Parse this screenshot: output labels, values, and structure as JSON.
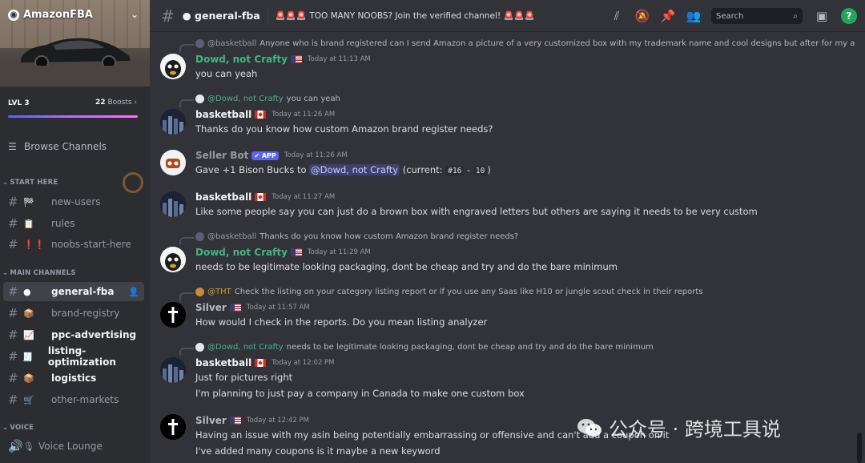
{
  "server": {
    "name": "AmazonFBA",
    "level": "LVL 3",
    "boosts_count": "22",
    "boosts_label": "Boosts"
  },
  "sidebar": {
    "browse_label": "Browse Channels",
    "categories": [
      {
        "label": "START HERE"
      },
      {
        "label": "MAIN CHANNELS"
      },
      {
        "label": "VOICE"
      }
    ],
    "channels": [
      {
        "emoji": "🏁",
        "label": "new-users"
      },
      {
        "emoji": "📋",
        "label": "rules"
      },
      {
        "emoji": "❗❗",
        "label": "noobs-start-here"
      },
      {
        "emoji": "●",
        "label": "general-fba"
      },
      {
        "emoji": "📦",
        "label": "brand-registry"
      },
      {
        "emoji": "📈",
        "label": "ppc-advertising"
      },
      {
        "emoji": "🧾",
        "label": "listing-optimization"
      },
      {
        "emoji": "📦",
        "label": "logistics"
      },
      {
        "emoji": "🛒",
        "label": "other-markets"
      },
      {
        "emoji": "🔊",
        "label": "Voice Lounge"
      }
    ]
  },
  "header": {
    "channel": "general-fba",
    "channel_prefix": "●",
    "topic_alarms": "🚨🚨🚨",
    "topic_text": "TOO MANY NOOBS? Join the verified channel!",
    "search_placeholder": "Search"
  },
  "messages": [
    {
      "reply_name": "@basketball",
      "reply_text": "Anyone who is brand registered can I send Amazon a picture of a very customized box with my trademark name and cool designs but after for my act...",
      "author": "Dowd, not Crafty",
      "time": "Today at 11:13 AM",
      "lines": [
        "you can yeah"
      ]
    },
    {
      "reply_name": "@Dowd, not Crafty",
      "reply_text": "you can yeah",
      "author": "basketball",
      "time": "Today at 11:26 AM",
      "lines": [
        "Thanks do you know how custom Amazon brand register needs?"
      ]
    },
    {
      "author": "Seller Bot",
      "badge": "✔ APP",
      "time": "Today at 11:26 AM",
      "line_pre": "Gave +1 Bison Bucks to ",
      "mention": "@Dowd, not Crafty",
      "line_mid": " (current: ",
      "code1": "#16",
      "dash": " - ",
      "code2": "10",
      "line_post": ")"
    },
    {
      "author": "basketball",
      "time": "Today at 11:27 AM",
      "lines": [
        "Like some people say you can just do a brown box with engraved letters but others are saying it needs to be very custom"
      ]
    },
    {
      "reply_name": "@basketball",
      "reply_text": "Thanks do you know how custom Amazon brand register needs?",
      "author": "Dowd, not Crafty",
      "time": "Today at 11:29 AM",
      "lines": [
        "needs to be legitimate looking packaging, dont be cheap and try and do the bare minimum"
      ]
    },
    {
      "reply_name": "@THT",
      "reply_text": "Check the listing on your category listing report or if you use any Saas like H10 or jungle scout check in their reports",
      "author": "Silver",
      "time": "Today at 11:57 AM",
      "lines": [
        "How would I check in the reports. Do you mean listing analyzer"
      ]
    },
    {
      "reply_name": "@Dowd, not Crafty",
      "reply_text": "needs to be legitimate looking packaging, dont be cheap and try and do the bare minimum",
      "author": "basketball",
      "time": "Today at 12:02 PM",
      "lines": [
        "Just for pictures right",
        "I'm planning to just pay a company in Canada to make one custom box"
      ]
    },
    {
      "author": "Silver",
      "time": "Today at 12:42 PM",
      "lines": [
        "Having an issue with my asin being potentially embarrassing or offensive and can't add a coupon on it",
        "I've added many coupons is it maybe a new keyword"
      ]
    }
  ],
  "watermark": "公众号 · 跨境工具说",
  "colors": {
    "accent": "#5865f2",
    "green_name": "#43b581",
    "bot_name": "#949ba4",
    "online": "#23a559"
  }
}
